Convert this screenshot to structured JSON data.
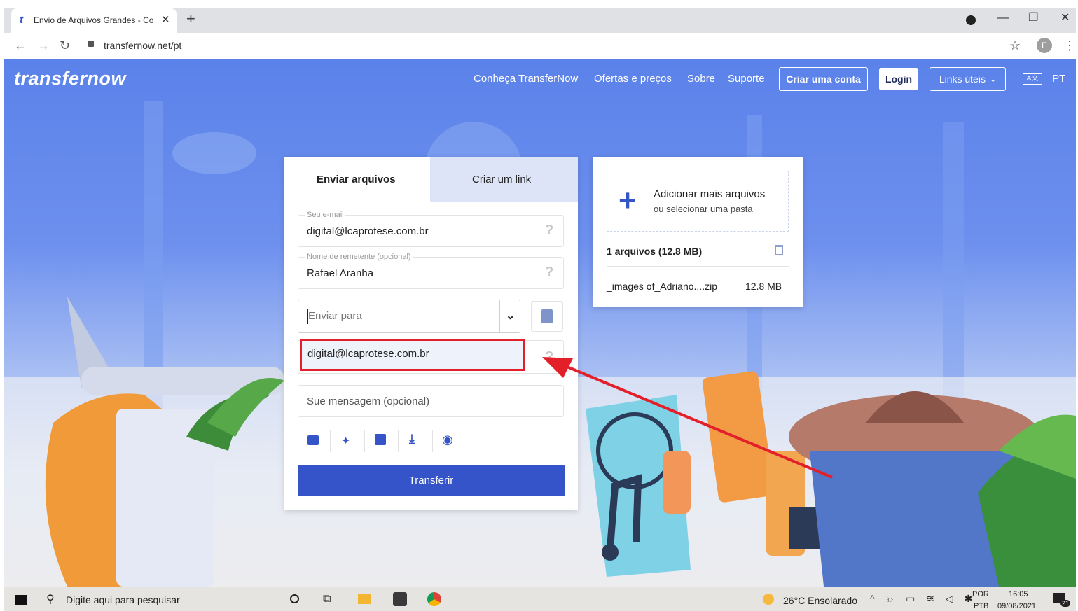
{
  "browser": {
    "tab_title": "Envio de Arquivos Grandes - Co",
    "new_tab": "+",
    "url": "transfernow.net/pt",
    "profile_initial": "E"
  },
  "site": {
    "logo": "transfernow",
    "nav": [
      "Conheça TransferNow",
      "Ofertas e preços",
      "Sobre",
      "Suporte"
    ],
    "create_account": "Criar uma conta",
    "login": "Login",
    "useful_links": "Links úteis",
    "language": "PT"
  },
  "form": {
    "tabs": [
      "Enviar arquivos",
      "Criar um link"
    ],
    "email_label": "Seu e-mail",
    "email_value": "digital@lcaprotese.com.br",
    "sender_label": "Nome de remetente (opcional)",
    "sender_value": "Rafael Aranha",
    "send_to_placeholder": "Enviar para",
    "recipient_value": "digital@lcaprotese.com.br",
    "message_placeholder": "Sue mensagem (opcional)",
    "help": "?",
    "submit": "Transferir"
  },
  "files": {
    "add_title": "Adicionar mais arquivos",
    "add_subtitle": "ou selecionar uma pasta",
    "summary": "1 arquivos (12.8 MB)",
    "file_name": "_images of_Adriano....zip",
    "file_size": "12.8 MB"
  },
  "taskbar": {
    "search": "Digite aqui para pesquisar",
    "weather": "26°C  Ensolarado",
    "lang_top": "POR",
    "lang_bottom": "PTB",
    "time": "16:05",
    "date": "09/08/2021",
    "notif": "21"
  },
  "colors": {
    "brand_blue": "#3554c9",
    "highlight_red": "#e3202a"
  }
}
